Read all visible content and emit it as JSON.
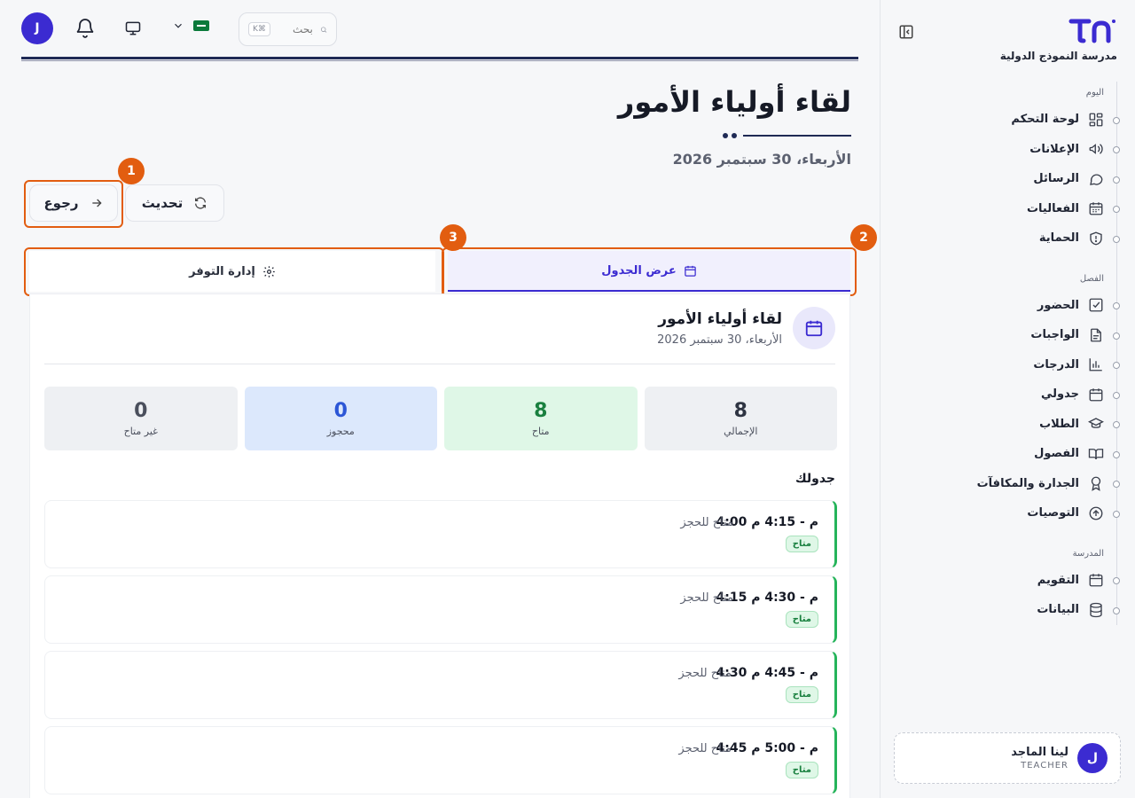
{
  "sidebar": {
    "brand_name": "مدرسة النموذج الدولية",
    "sections": {
      "today": "اليوم",
      "class": "الفصل",
      "school": "المدرسة"
    },
    "items": {
      "dashboard": "لوحة التحكم",
      "announcements": "الإعلانات",
      "messages": "الرسائل",
      "events": "الفعاليات",
      "safety": "الحماية",
      "attendance": "الحضور",
      "homework": "الواجبات",
      "grades": "الدرجات",
      "schedule": "جدولي",
      "students": "الطلاب",
      "classes": "الفصول",
      "merit": "الجدارة والمكافآت",
      "recommendations": "التوصيات",
      "calendar": "التقويم",
      "data": "البيانات"
    },
    "user": {
      "initial": "ل",
      "name": "لينا الماجد",
      "role": "TEACHER"
    }
  },
  "topbar": {
    "avatar_initial": "J",
    "search_placeholder": "بحث",
    "shortcut": "K⌘"
  },
  "header": {
    "title": "لقاء أولياء الأمور",
    "date": "الأربعاء، 30 سبتمبر 2026"
  },
  "actions": {
    "back_label": "رجوع",
    "refresh_label": "تحديث"
  },
  "annotations": [
    "1",
    "2",
    "3"
  ],
  "tabs": {
    "schedule_view": "عرض الجدول",
    "availability": "إدارة التوفر"
  },
  "card": {
    "title": "لقاء أولياء الأمور",
    "date": "الأربعاء، 30 سبتمبر 2026",
    "stats": [
      {
        "value": "8",
        "label": "الإجمالي"
      },
      {
        "value": "8",
        "label": "متاح"
      },
      {
        "value": "0",
        "label": "محجوز"
      },
      {
        "value": "0",
        "label": "غير متاح"
      }
    ],
    "section_title": "جدولك",
    "slots": [
      {
        "time": "4:00 م - 4:15 م",
        "status": "متاح للحجز",
        "badge": "متاح"
      },
      {
        "time": "4:15 م - 4:30 م",
        "status": "متاح للحجز",
        "badge": "متاح"
      },
      {
        "time": "4:30 م - 4:45 م",
        "status": "متاح للحجز",
        "badge": "متاح"
      },
      {
        "time": "4:45 م - 5:00 م",
        "status": "متاح للحجز",
        "badge": "متاح"
      }
    ]
  },
  "colors": {
    "accent": "#3b2bd1",
    "highlight": "#e25d10",
    "available": "#25b45a"
  }
}
